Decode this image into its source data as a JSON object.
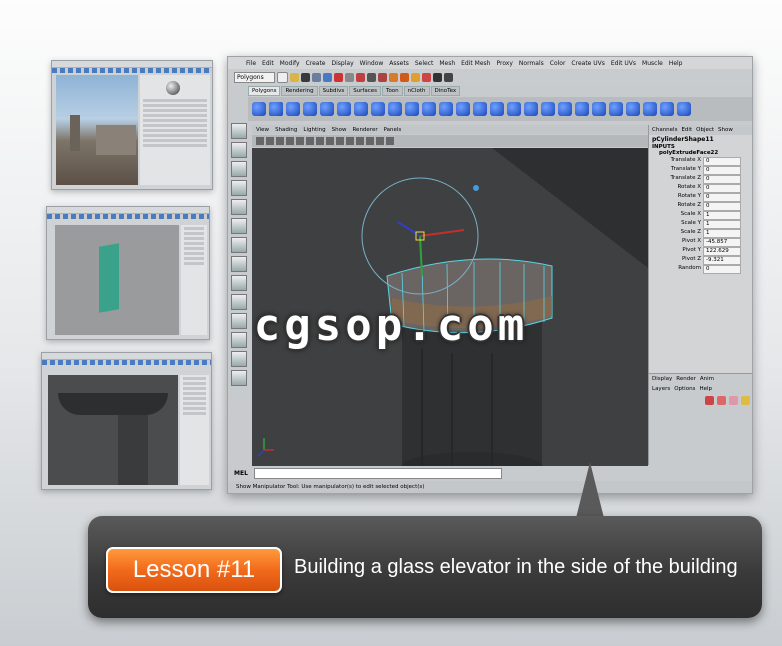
{
  "watermark": "cgsop.com",
  "lesson": {
    "number_label": "Lesson #11",
    "description": "Building a glass elevator in the side of the building"
  },
  "app": {
    "menu": [
      "File",
      "Edit",
      "Modify",
      "Create",
      "Display",
      "Window",
      "Assets",
      "Select",
      "Mesh",
      "Edit Mesh",
      "Proxy",
      "Normals",
      "Color",
      "Create UVs",
      "Edit UVs",
      "Muscle",
      "Help"
    ],
    "mode_selector": "Polygons",
    "shelf_tabs": [
      "Polygons",
      "Rendering",
      "Subdivs",
      "Surfaces",
      "Toon",
      "nCloth",
      "DinoTex"
    ],
    "viewport_menu": [
      "View",
      "Shading",
      "Lighting",
      "Show",
      "Renderer",
      "Panels"
    ],
    "channel_box": {
      "tabs": [
        "Channels",
        "Edit",
        "Object",
        "Show"
      ],
      "shape_name": "pCylinderShape11",
      "inputs_label": "INPUTS",
      "node_name": "polyExtrudeFace22",
      "attributes": [
        {
          "name": "Translate X",
          "value": "0"
        },
        {
          "name": "Translate Y",
          "value": "0"
        },
        {
          "name": "Translate Z",
          "value": "0"
        },
        {
          "name": "Rotate X",
          "value": "0"
        },
        {
          "name": "Rotate Y",
          "value": "0"
        },
        {
          "name": "Rotate Z",
          "value": "0"
        },
        {
          "name": "Scale X",
          "value": "1"
        },
        {
          "name": "Scale Y",
          "value": "1"
        },
        {
          "name": "Scale Z",
          "value": "1"
        },
        {
          "name": "Pivot X",
          "value": "-45.857"
        },
        {
          "name": "Pivot Y",
          "value": "122.629"
        },
        {
          "name": "Pivot Z",
          "value": "-9.321"
        },
        {
          "name": "Random",
          "value": "0"
        }
      ]
    },
    "layer_editor": {
      "tabs": [
        "Display",
        "Render",
        "Anim"
      ],
      "menu": [
        "Layers",
        "Options",
        "Help"
      ]
    },
    "command_line_label": "MEL",
    "help_line": "Show Manipulator Tool: Use manipulator(s) to edit selected object(s)"
  },
  "colors": {
    "lesson_orange": "#f26a1b",
    "banner_dark": "#3a3a3a",
    "viewport_dark": "#3b3c3d",
    "selection_cyan": "#58d6e6"
  }
}
